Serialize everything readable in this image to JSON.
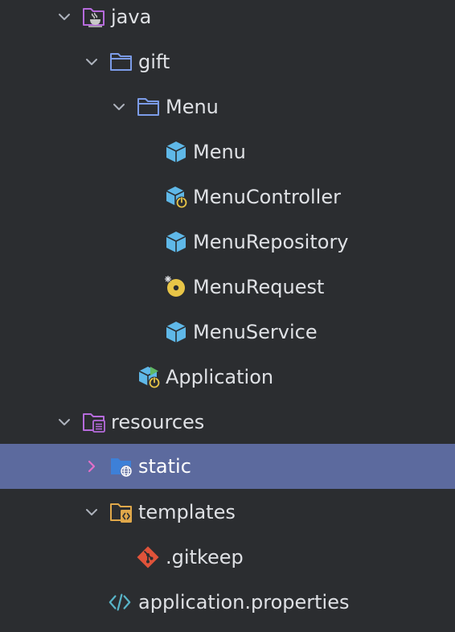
{
  "tree": {
    "selected_color": "#5c6a9e",
    "rows": [
      {
        "label": "java",
        "icon": "java-source-folder-icon",
        "expanded": true
      },
      {
        "label": "gift",
        "icon": "package-folder-icon",
        "expanded": true
      },
      {
        "label": "Menu",
        "icon": "package-folder-icon",
        "expanded": true
      },
      {
        "label": "Menu",
        "icon": "class-icon"
      },
      {
        "label": "MenuController",
        "icon": "spring-bean-class-icon"
      },
      {
        "label": "MenuRepository",
        "icon": "class-icon"
      },
      {
        "label": "MenuRequest",
        "icon": "record-icon"
      },
      {
        "label": "MenuService",
        "icon": "class-icon"
      },
      {
        "label": "Application",
        "icon": "spring-boot-application-icon"
      },
      {
        "label": "resources",
        "icon": "resources-folder-icon",
        "expanded": true
      },
      {
        "label": "static",
        "icon": "web-folder-icon",
        "expanded": false,
        "selected": true
      },
      {
        "label": "templates",
        "icon": "templates-folder-icon",
        "expanded": true
      },
      {
        "label": ".gitkeep",
        "icon": "git-file-icon"
      },
      {
        "label": "application.properties",
        "icon": "properties-file-icon"
      }
    ]
  }
}
